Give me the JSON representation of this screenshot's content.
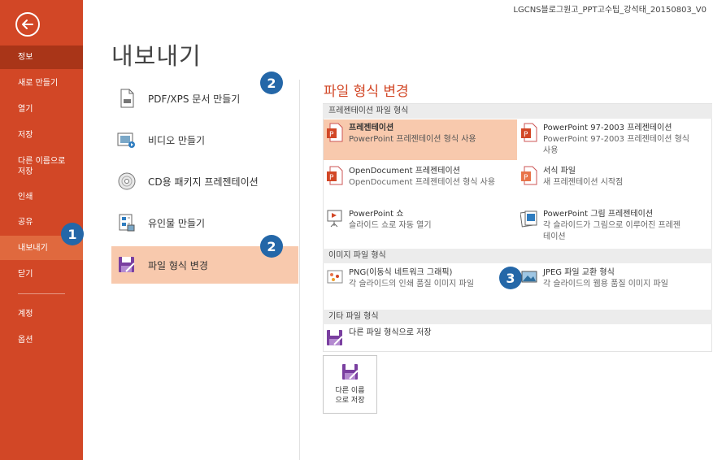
{
  "window": {
    "doc_title": "LGCNS블로그원고_PPT고수팁_강석태_20150803_V0"
  },
  "sidebar": {
    "items": [
      {
        "label": "정보"
      },
      {
        "label": "새로 만들기"
      },
      {
        "label": "열기"
      },
      {
        "label": "저장"
      },
      {
        "label": "다른 이름으로 저장"
      },
      {
        "label": "인쇄"
      },
      {
        "label": "공유"
      },
      {
        "label": "내보내기"
      },
      {
        "label": "닫기"
      },
      {
        "label": "계정"
      },
      {
        "label": "옵션"
      }
    ]
  },
  "page": {
    "title": "내보내기"
  },
  "export_menu": {
    "items": [
      {
        "label": "PDF/XPS 문서 만들기"
      },
      {
        "label": "비디오 만들기"
      },
      {
        "label": "CD용 패키지 프레젠테이션"
      },
      {
        "label": "유인물 만들기"
      },
      {
        "label": "파일 형식 변경"
      }
    ]
  },
  "badges": {
    "b1": "1",
    "b2a": "2",
    "b2b": "2",
    "b3": "3"
  },
  "change_type": {
    "title": "파일 형식 변경",
    "groups": {
      "presentation": {
        "header": "프레젠테이션 파일 형식",
        "options": [
          {
            "t1": "프레젠테이션",
            "t2": "PowerPoint 프레젠테이션 형식 사용"
          },
          {
            "t1": "PowerPoint 97-2003 프레젠테이션",
            "t2a": "PowerPoint 97-2003 프레젠테이션 형식",
            "t2b": "사용"
          },
          {
            "t1": "OpenDocument 프레젠테이션",
            "t2": "OpenDocument 프레젠테이션 형식 사용"
          },
          {
            "t1": "서식 파일",
            "t2": "새 프레젠테이션 시작점"
          },
          {
            "t1": "PowerPoint 쇼",
            "t2": "슬라이드 쇼로 자동 열기"
          },
          {
            "t1": "PowerPoint 그림 프레젠테이션",
            "t2a": "각 슬라이드가 그림으로 이루어진 프레젠",
            "t2b": "테이션"
          }
        ]
      },
      "image": {
        "header": "이미지 파일 형식",
        "options": [
          {
            "t1": "PNG(이동식 네트워크 그래픽)",
            "t2": "각 슬라이드의 인쇄 품질 이미지 파일"
          },
          {
            "t1": "JPEG 파일 교환 형식",
            "t2": "각 슬라이드의 웹용 품질 이미지 파일"
          }
        ]
      },
      "other": {
        "header": "기타 파일 형식",
        "options": [
          {
            "t1": "다른 파일 형식으로 저장"
          }
        ]
      }
    },
    "save_as_button": {
      "line1": "다른 이름",
      "line2": "으로 저장"
    }
  },
  "colors": {
    "accent": "#d24726",
    "selected": "#f8c9ad",
    "badge": "#2467a8",
    "sidebar_active": "#a93518"
  }
}
